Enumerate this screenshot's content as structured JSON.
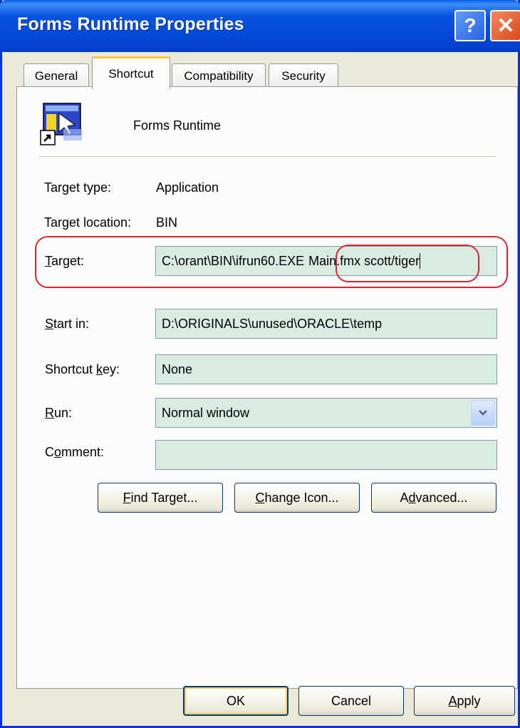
{
  "window": {
    "title": "Forms Runtime Properties",
    "help_glyph": "?",
    "close_glyph": "✕"
  },
  "tabs": [
    {
      "label": "General",
      "active": false
    },
    {
      "label": "Shortcut",
      "active": true
    },
    {
      "label": "Compatibility",
      "active": false
    },
    {
      "label": "Security",
      "active": false
    }
  ],
  "shortcut": {
    "name": "Forms Runtime",
    "icon": "forms-runtime-shortcut-icon",
    "target_type_label": "Target type:",
    "target_type_value": "Application",
    "target_location_label": "Target location:",
    "target_location_value": "BIN",
    "target_label_key": "T",
    "target_label_rest": "arget:",
    "target_value_exe": "C:\\orant\\BIN\\ifrun60.EXE",
    "target_value_args": "Main.fmx scott/tiger",
    "start_in_label_key": "S",
    "start_in_label_rest": "tart in:",
    "start_in_value": "D:\\ORIGINALS\\unused\\ORACLE\\temp",
    "shortcut_key_label_pre": "Shortcut ",
    "shortcut_key_label_key": "k",
    "shortcut_key_label_rest": "ey:",
    "shortcut_key_value": "None",
    "run_label_key": "R",
    "run_label_rest": "un:",
    "run_value": "Normal window",
    "comment_label_pre": "C",
    "comment_label_key": "o",
    "comment_label_rest": "mment:",
    "comment_value": ""
  },
  "buttons": {
    "find_target_key": "F",
    "find_target_rest": "ind Target...",
    "change_icon_key": "C",
    "change_icon_rest": "hange Icon...",
    "advanced_pre": "A",
    "advanced_key": "d",
    "advanced_rest": "vanced...",
    "ok": "OK",
    "cancel": "Cancel",
    "apply_key": "A",
    "apply_rest": "pply"
  },
  "colors": {
    "highlight": "#e0242c",
    "field_bg": "#d8ece1",
    "titlebar": "#0448d6"
  }
}
